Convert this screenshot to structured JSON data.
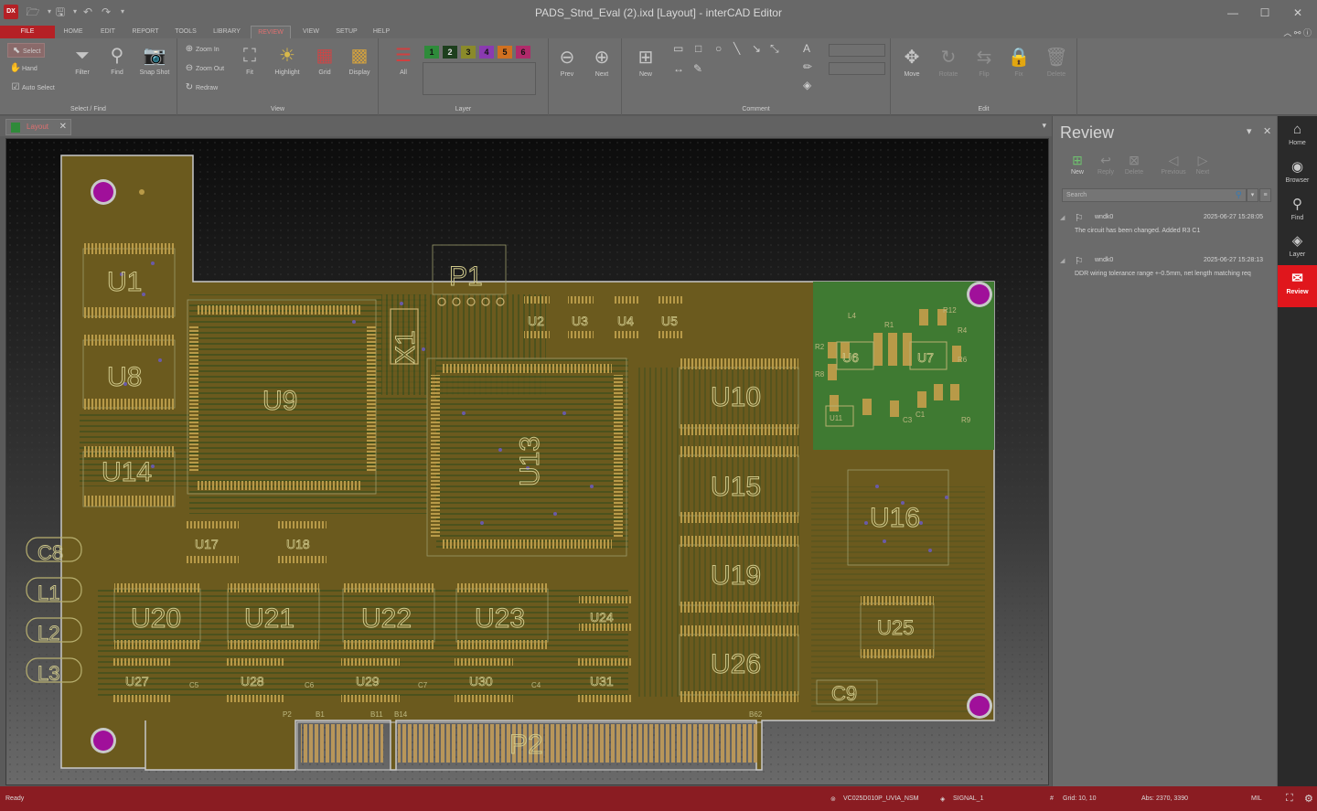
{
  "window": {
    "title": "PADS_Stnd_Eval (2).ixd [Layout] - interCAD Editor",
    "logo_text": "DX",
    "controls": [
      "—",
      "☐",
      "✕"
    ]
  },
  "menu": {
    "tabs": [
      "FILE",
      "HOME",
      "EDIT",
      "REPORT",
      "TOOLS",
      "LIBRARY",
      "REVIEW",
      "VIEW",
      "SETUP",
      "HELP"
    ],
    "active": "REVIEW"
  },
  "ribbon": {
    "select_find": {
      "label": "Select / Find",
      "select": "Select",
      "hand": "Hand",
      "auto_select": "Auto Select",
      "filter": "Filter",
      "find": "Find",
      "snap_shot": "Snap Shot"
    },
    "view": {
      "label": "View",
      "zoom_in": "Zoom In",
      "zoom_out": "Zoom Out",
      "redraw": "Redraw",
      "fit": "Fit",
      "highlight": "Highlight",
      "grid": "Grid",
      "display": "Display"
    },
    "layer": {
      "label": "Layer",
      "all": "All",
      "numbers": [
        "1",
        "2",
        "3",
        "4",
        "5",
        "6"
      ],
      "colors": [
        "#2e8b3a",
        "#1a3a1a",
        "#8a8a2a",
        "#8a3ab0",
        "#d07020",
        "#b02a6a"
      ]
    },
    "nav": {
      "prev": "Prev",
      "next": "Next"
    },
    "comment": {
      "label": "Comment",
      "new": "New"
    },
    "edit": {
      "label": "Edit",
      "move": "Move",
      "rotate": "Rotate",
      "flip": "Flip",
      "fix": "Fix",
      "delete": "Delete"
    }
  },
  "document": {
    "tab": "Layout"
  },
  "board": {
    "components_large": [
      "U1",
      "U8",
      "U9",
      "U14",
      "U13",
      "U10",
      "U15",
      "U19",
      "U26",
      "U16",
      "U20",
      "U21",
      "U22",
      "U23",
      "U25",
      "P1",
      "P2",
      "X1",
      "C9"
    ],
    "components_small": [
      "U2",
      "U3",
      "U4",
      "U5",
      "U6",
      "U7",
      "U17",
      "U18",
      "U24",
      "U27",
      "U28",
      "U29",
      "U30",
      "U31",
      "U11",
      "C5",
      "C6",
      "C7",
      "C8",
      "L1",
      "L2",
      "L3",
      "L4",
      "R1",
      "R2",
      "R4",
      "R6",
      "R8",
      "R9",
      "R12",
      "C1",
      "C3",
      "C4"
    ],
    "pin_labels": [
      "B1",
      "B11",
      "B14",
      "B62",
      "P2"
    ]
  },
  "review_panel": {
    "title": "Review",
    "buttons": [
      "New",
      "Reply",
      "Delete",
      "Previous",
      "Next"
    ],
    "search_placeholder": "Search",
    "comments": [
      {
        "author": "wndk0",
        "date": "2025-06-27 15:28:05",
        "text": "The circuit has been changed. Added R3 C1"
      },
      {
        "author": "wndk0",
        "date": "2025-06-27 15:28:13",
        "text": "DDR wiring tolerance range +-0.5mm, net length matching req"
      }
    ]
  },
  "sidebar": {
    "items": [
      "Home",
      "Browser",
      "Find",
      "Layer",
      "Review"
    ],
    "active": "Review"
  },
  "status": {
    "ready": "Ready",
    "net": "VC025D010P_UVIA_NSM",
    "layer": "SIGNAL_1",
    "grid": "Grid: 10, 10",
    "abs": "Abs: 2370, 3390",
    "unit": "MIL"
  }
}
